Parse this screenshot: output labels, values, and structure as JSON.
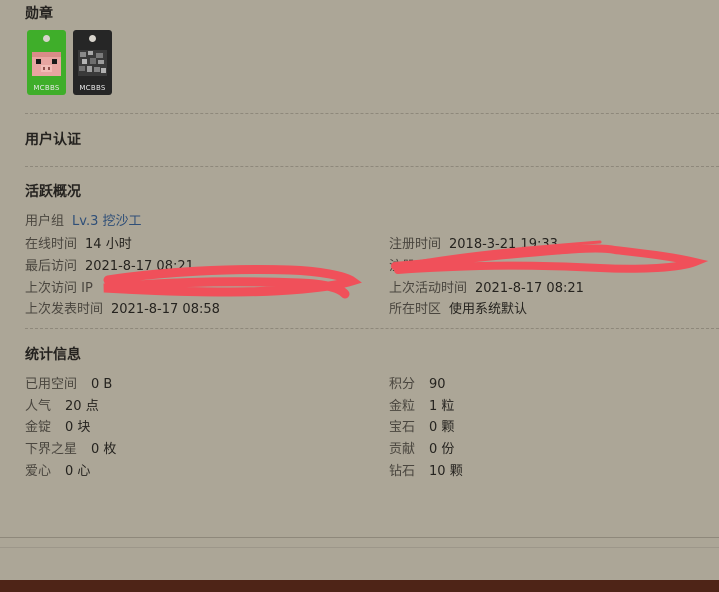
{
  "badges": {
    "title": "勋章",
    "items": [
      {
        "label": "MCBBS",
        "icon": "pig-icon",
        "color": "#3fae2a"
      },
      {
        "label": "MCBBS",
        "icon": "gravel-icon",
        "color": "#262626"
      }
    ]
  },
  "verification": {
    "title": "用户认证"
  },
  "activity": {
    "title": "活跃概况",
    "usergroup_label": "用户组",
    "usergroup_value": "Lv.3 挖沙工",
    "online_label": "在线时间",
    "online_value": "14 小时",
    "register_label": "注册时间",
    "register_value": "2018-3-21 19:33",
    "last_visit_label": "最后访问",
    "last_visit_value": "2021-8-17 08:21",
    "register_ip_label": "注册 IP",
    "last_ip_label": "上次访问 IP",
    "last_active_label": "上次活动时间",
    "last_active_value": "2021-8-17 08:21",
    "last_post_label": "上次发表时间",
    "last_post_value": "2021-8-17 08:58",
    "timezone_label": "所在时区",
    "timezone_value": "使用系统默认"
  },
  "stats": {
    "title": "统计信息",
    "left": [
      {
        "label": "已用空间",
        "value": "0 B"
      },
      {
        "label": "人气",
        "value": "20 点"
      },
      {
        "label": "金锭",
        "value": "0 块"
      },
      {
        "label": "下界之星",
        "value": "0 枚"
      },
      {
        "label": "爱心",
        "value": "0 心"
      }
    ],
    "right": [
      {
        "label": "积分",
        "value": "90"
      },
      {
        "label": "金粒",
        "value": "1 粒"
      },
      {
        "label": "宝石",
        "value": "0 颗"
      },
      {
        "label": "贡献",
        "value": "0 份"
      },
      {
        "label": "钻石",
        "value": "10 颗"
      }
    ]
  },
  "colors": {
    "background": "#aca697",
    "link": "#2f4f78",
    "redaction": "#f0505a",
    "bottom_bar": "#4e2417"
  }
}
